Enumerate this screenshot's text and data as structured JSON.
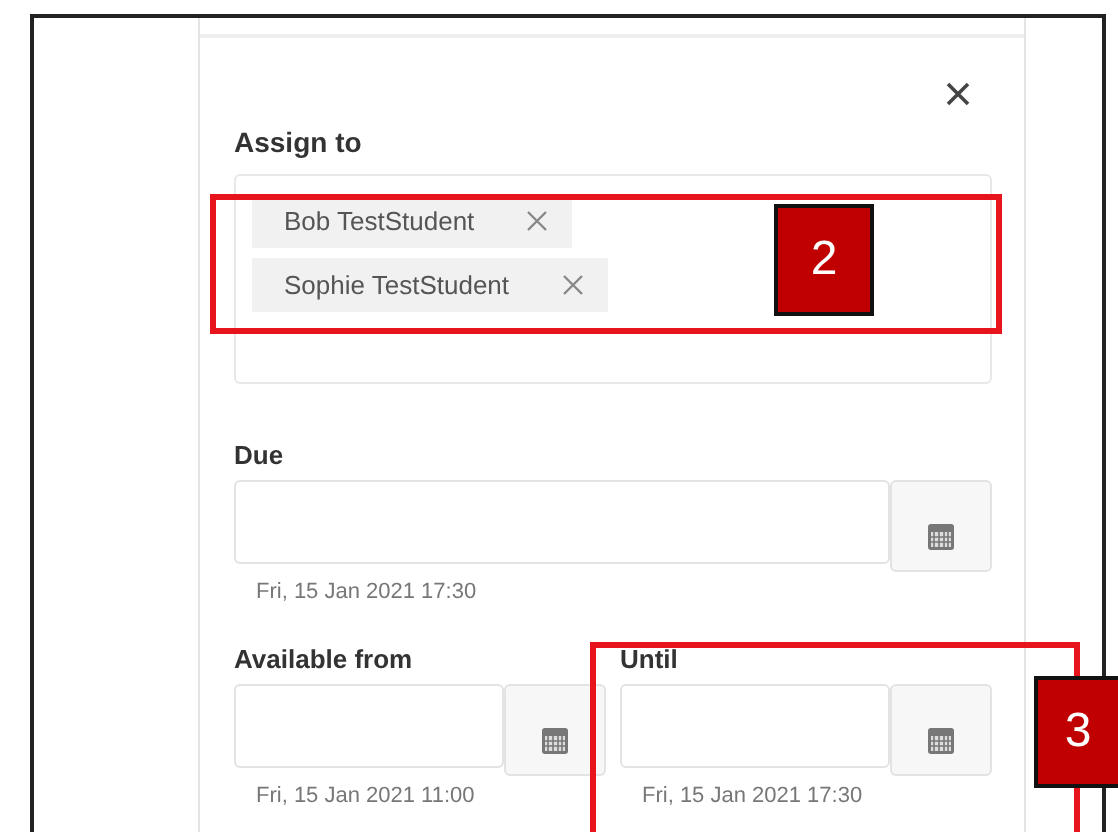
{
  "assign_to": {
    "label": "Assign to",
    "chips": [
      {
        "name": "Bob TestStudent"
      },
      {
        "name": "Sophie TestStudent"
      }
    ]
  },
  "due": {
    "label": "Due",
    "hint": "Fri, 15 Jan 2021 17:30"
  },
  "available_from": {
    "label": "Available from",
    "hint": "Fri, 15 Jan 2021 11:00"
  },
  "until": {
    "label": "Until",
    "hint": "Fri, 15 Jan 2021 17:30"
  },
  "annotations": [
    {
      "number": "2"
    },
    {
      "number": "3"
    }
  ]
}
